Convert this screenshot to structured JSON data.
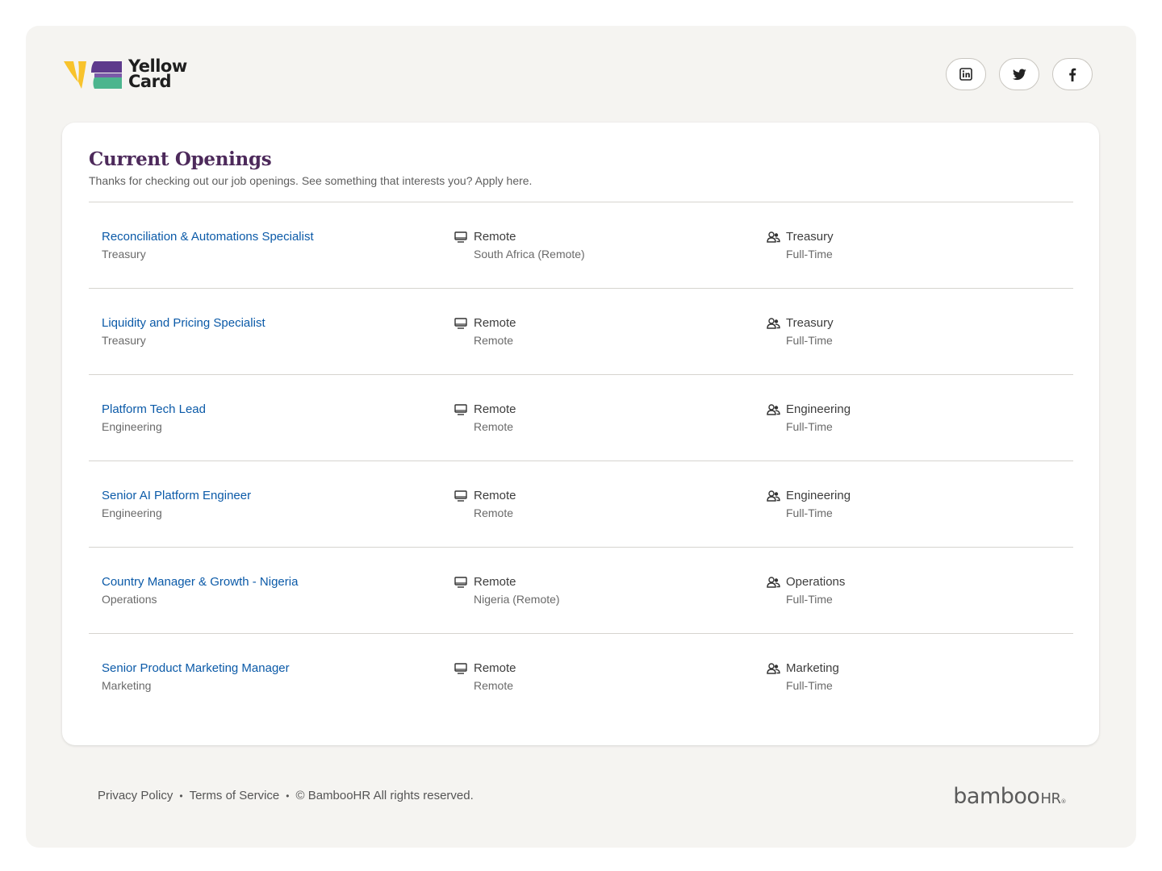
{
  "brand": {
    "line1": "Yellow",
    "line2": "Card",
    "colors": {
      "yellow": "#f8c32c",
      "purple": "#5e3a8c",
      "green": "#4cb58e"
    }
  },
  "social": [
    {
      "name": "linkedin",
      "icon": "linkedin-icon"
    },
    {
      "name": "twitter",
      "icon": "twitter-icon"
    },
    {
      "name": "facebook",
      "icon": "facebook-icon"
    }
  ],
  "openings": {
    "title": "Current Openings",
    "subtitle": "Thanks for checking out our job openings. See something that interests you? Apply here.",
    "jobs": [
      {
        "title": "Reconciliation & Automations Specialist",
        "department": "Treasury",
        "location_type": "Remote",
        "location": "South Africa (Remote)",
        "team": "Treasury",
        "employment": "Full-Time"
      },
      {
        "title": "Liquidity and Pricing Specialist",
        "department": "Treasury",
        "location_type": "Remote",
        "location": "Remote",
        "team": "Treasury",
        "employment": "Full-Time"
      },
      {
        "title": "Platform Tech Lead",
        "department": "Engineering",
        "location_type": "Remote",
        "location": "Remote",
        "team": "Engineering",
        "employment": "Full-Time"
      },
      {
        "title": "Senior AI Platform Engineer",
        "department": "Engineering",
        "location_type": "Remote",
        "location": "Remote",
        "team": "Engineering",
        "employment": "Full-Time"
      },
      {
        "title": "Country Manager & Growth - Nigeria",
        "department": "Operations",
        "location_type": "Remote",
        "location": "Nigeria (Remote)",
        "team": "Operations",
        "employment": "Full-Time"
      },
      {
        "title": "Senior Product Marketing Manager",
        "department": "Marketing",
        "location_type": "Remote",
        "location": "Remote",
        "team": "Marketing",
        "employment": "Full-Time"
      }
    ]
  },
  "footer": {
    "privacy": "Privacy Policy",
    "terms": "Terms of Service",
    "separator": "•",
    "copyright": "© BambooHR All rights reserved.",
    "bamboo_main": "bamboo",
    "bamboo_hr": "HR",
    "bamboo_reg": "®"
  }
}
